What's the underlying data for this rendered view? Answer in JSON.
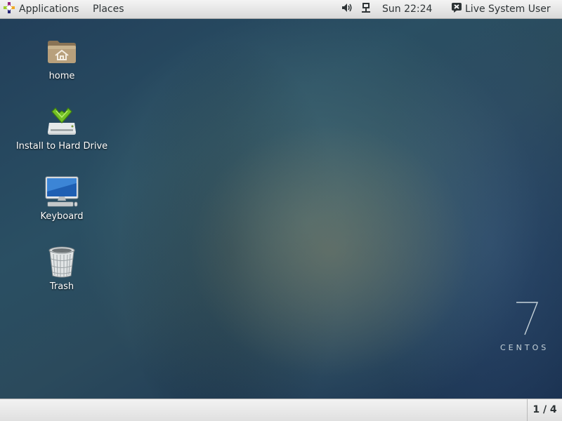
{
  "top_bar": {
    "applications_label": "Applications",
    "places_label": "Places",
    "volume_icon": "speaker-icon",
    "network_icon": "wired-network-icon",
    "clock": "Sun 22:24",
    "user_label": "Live System User",
    "user_icon": "user-status-icon"
  },
  "desktop": {
    "icons": [
      {
        "label": "home",
        "icon": "home-folder-icon"
      },
      {
        "label": "Install to Hard Drive",
        "icon": "install-drive-icon"
      },
      {
        "label": "Keyboard",
        "icon": "monitor-keyboard-icon"
      },
      {
        "label": "Trash",
        "icon": "trash-icon"
      }
    ],
    "logo": {
      "number": "7",
      "text": "CENTOS"
    }
  },
  "bottom_bar": {
    "workspace": "1 / 4"
  },
  "colors": {
    "panel": "#e6e6e6",
    "panel_text": "#2e3436",
    "desktop_base": "#223f5a"
  }
}
